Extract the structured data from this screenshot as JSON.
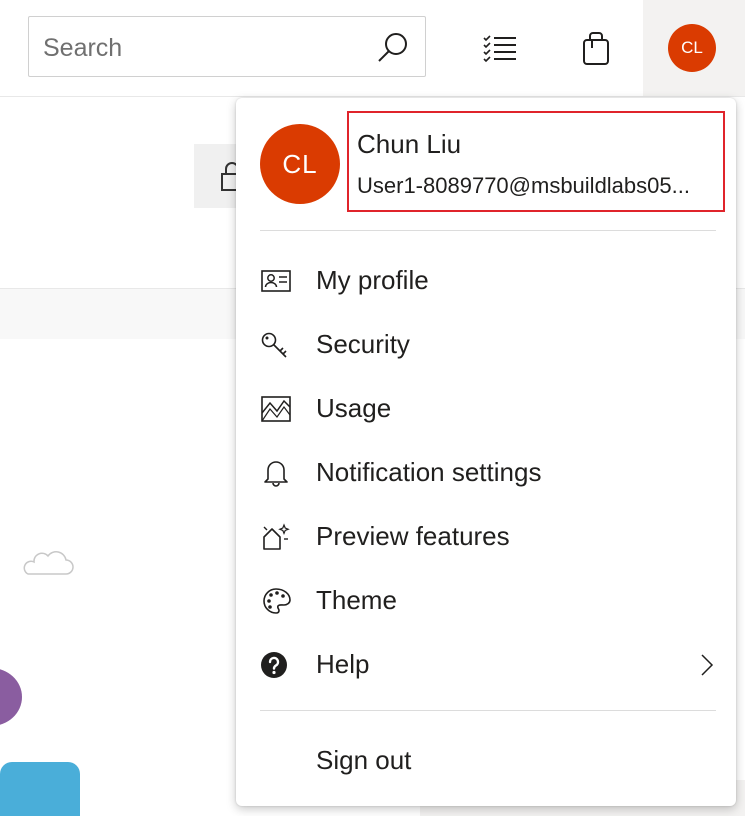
{
  "header": {
    "search": {
      "placeholder": "Search",
      "value": ""
    },
    "avatar_initials": "CL"
  },
  "menu": {
    "avatar_initials": "CL",
    "user": {
      "name": "Chun Liu",
      "email": "User1-8089770@msbuildlabs05..."
    },
    "items": [
      {
        "label": "My profile",
        "icon": "contact-card-icon"
      },
      {
        "label": "Security",
        "icon": "key-icon"
      },
      {
        "label": "Usage",
        "icon": "usage-chart-icon"
      },
      {
        "label": "Notification settings",
        "icon": "bell-icon"
      },
      {
        "label": "Preview features",
        "icon": "preview-sparkle-icon"
      },
      {
        "label": "Theme",
        "icon": "palette-icon"
      },
      {
        "label": "Help",
        "icon": "help-circle-icon"
      }
    ],
    "sign_out_label": "Sign out"
  },
  "colors": {
    "avatar": "#da3b01",
    "highlight_border": "#e0242b"
  }
}
